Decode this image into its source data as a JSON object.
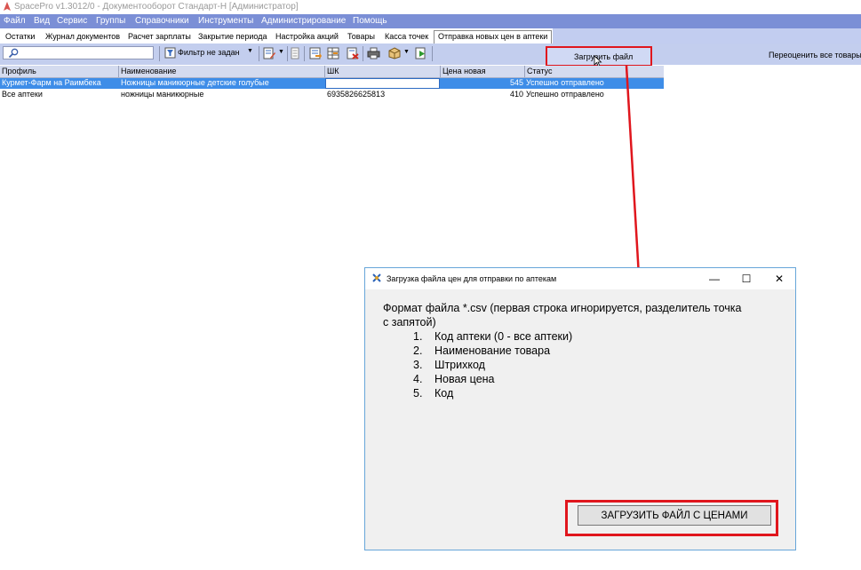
{
  "window": {
    "title": "SpacePro v1.3012/0 - Документооборот Стандарт-Н [Администратор]"
  },
  "menu": [
    "Файл",
    "Вид",
    "Сервис",
    "Группы",
    "Справочники",
    "Инструменты",
    "Администрирование",
    "Помощь"
  ],
  "tabs": [
    "Остатки",
    "Журнал документов",
    "Расчет зарплаты",
    "Закрытие периода",
    "Настройка акций",
    "Товары",
    "Касса точек",
    "Отправка новых цен в аптеки"
  ],
  "toolbar": {
    "search_value": "",
    "filter_label": "Фильтр не задан",
    "load_file_label": "Загрузить файл",
    "reprice_label": "Переоценить все товары"
  },
  "grid": {
    "columns": [
      "Профиль",
      "Наименование",
      "ШК",
      "Цена новая",
      "Статус"
    ],
    "rows": [
      {
        "profile": "Курмет-Фарм на Раимбека",
        "name": "Ножницы маникюрные детские голубые",
        "barcode": "",
        "price": "545",
        "status": "Успешно отправлено",
        "selected": true
      },
      {
        "profile": "Все аптеки",
        "name": "ножницы маникюрные",
        "barcode": "6935826625813",
        "price": "410",
        "status": "Успешно отправлено",
        "selected": false
      }
    ]
  },
  "dialog": {
    "title": "Загрузка файла цен для отправки по аптекам",
    "minimize": "—",
    "maximize": "☐",
    "close": "✕",
    "intro_line1": "Формат файла *.csv (первая строка игнорируется, разделитель точка",
    "intro_line2": "с запятой)",
    "items": [
      {
        "num": "1.",
        "text": "Код аптеки (0 - все аптеки)"
      },
      {
        "num": "2.",
        "text": "Наименование товара"
      },
      {
        "num": "3.",
        "text": "Штрихкод"
      },
      {
        "num": "4.",
        "text": "Новая цена"
      },
      {
        "num": "5.",
        "text": "Код"
      }
    ],
    "upload_button": "ЗАГРУЗИТЬ ФАЙЛ С ЦЕНАМИ"
  },
  "colors": {
    "menu_bg": "#7b8fd6",
    "toolbar_bg": "#c3ceee",
    "selection": "#3e8de8",
    "annotation_red": "#e0161d"
  }
}
